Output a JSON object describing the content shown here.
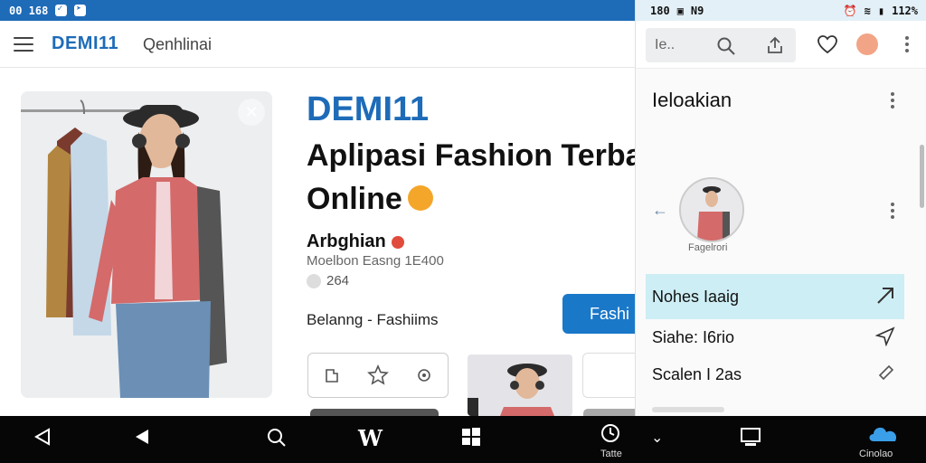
{
  "status_left": {
    "time": "00 168"
  },
  "status_right": {
    "time": "180",
    "network": "N9",
    "battery": "112%"
  },
  "appbar": {
    "brand": "DEMI11",
    "subtitle": "Qenhlinai"
  },
  "main": {
    "app_name": "DEMI11",
    "headline": "Aplipasi Fashion Terbatkn Belama Online",
    "author": "Arbghian",
    "author_meta": "Moelbon Easng 1E400",
    "likes": "264",
    "category": "Belanng - Fashiims",
    "cta_label": "Fashi"
  },
  "panel": {
    "search_value": "Ie..",
    "title": "Ieloakian",
    "profile_caption": "Fagelrori",
    "menu": [
      {
        "label": "Nohes Iaaig",
        "active": true
      },
      {
        "label": "Siahe: I6rio",
        "active": false
      },
      {
        "label": "Scalen I 2as",
        "active": false
      }
    ]
  },
  "navbar": {
    "time_label": "Tatte",
    "account_label": "Cinolao"
  },
  "colors": {
    "brand_blue": "#1e6bb8",
    "active_menu": "#cdeef4",
    "cta": "#1a78c9"
  }
}
